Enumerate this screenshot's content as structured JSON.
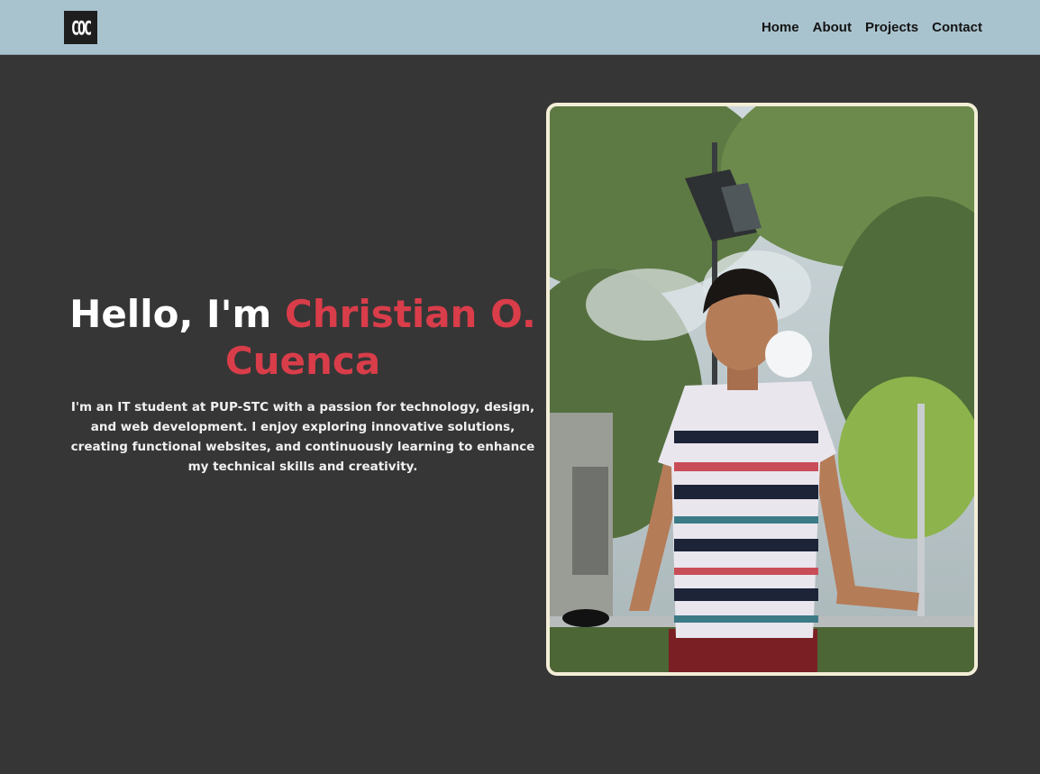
{
  "header": {
    "logo_text": "COC",
    "nav": [
      "Home",
      "About",
      "Projects",
      "Contact"
    ]
  },
  "hero": {
    "greeting": "Hello, I'm ",
    "name": "Christian O. Cuenca",
    "description": "I'm an IT student at PUP-STC with a passion for technology, design, and web development. I enjoy exploring innovative solutions, creating functional websites, and continuously learning to enhance my technical skills and creativity."
  },
  "colors": {
    "navbar": "#a9c3ce",
    "background": "#363636",
    "accent": "#d93d4a",
    "frame": "#f3eed8"
  }
}
